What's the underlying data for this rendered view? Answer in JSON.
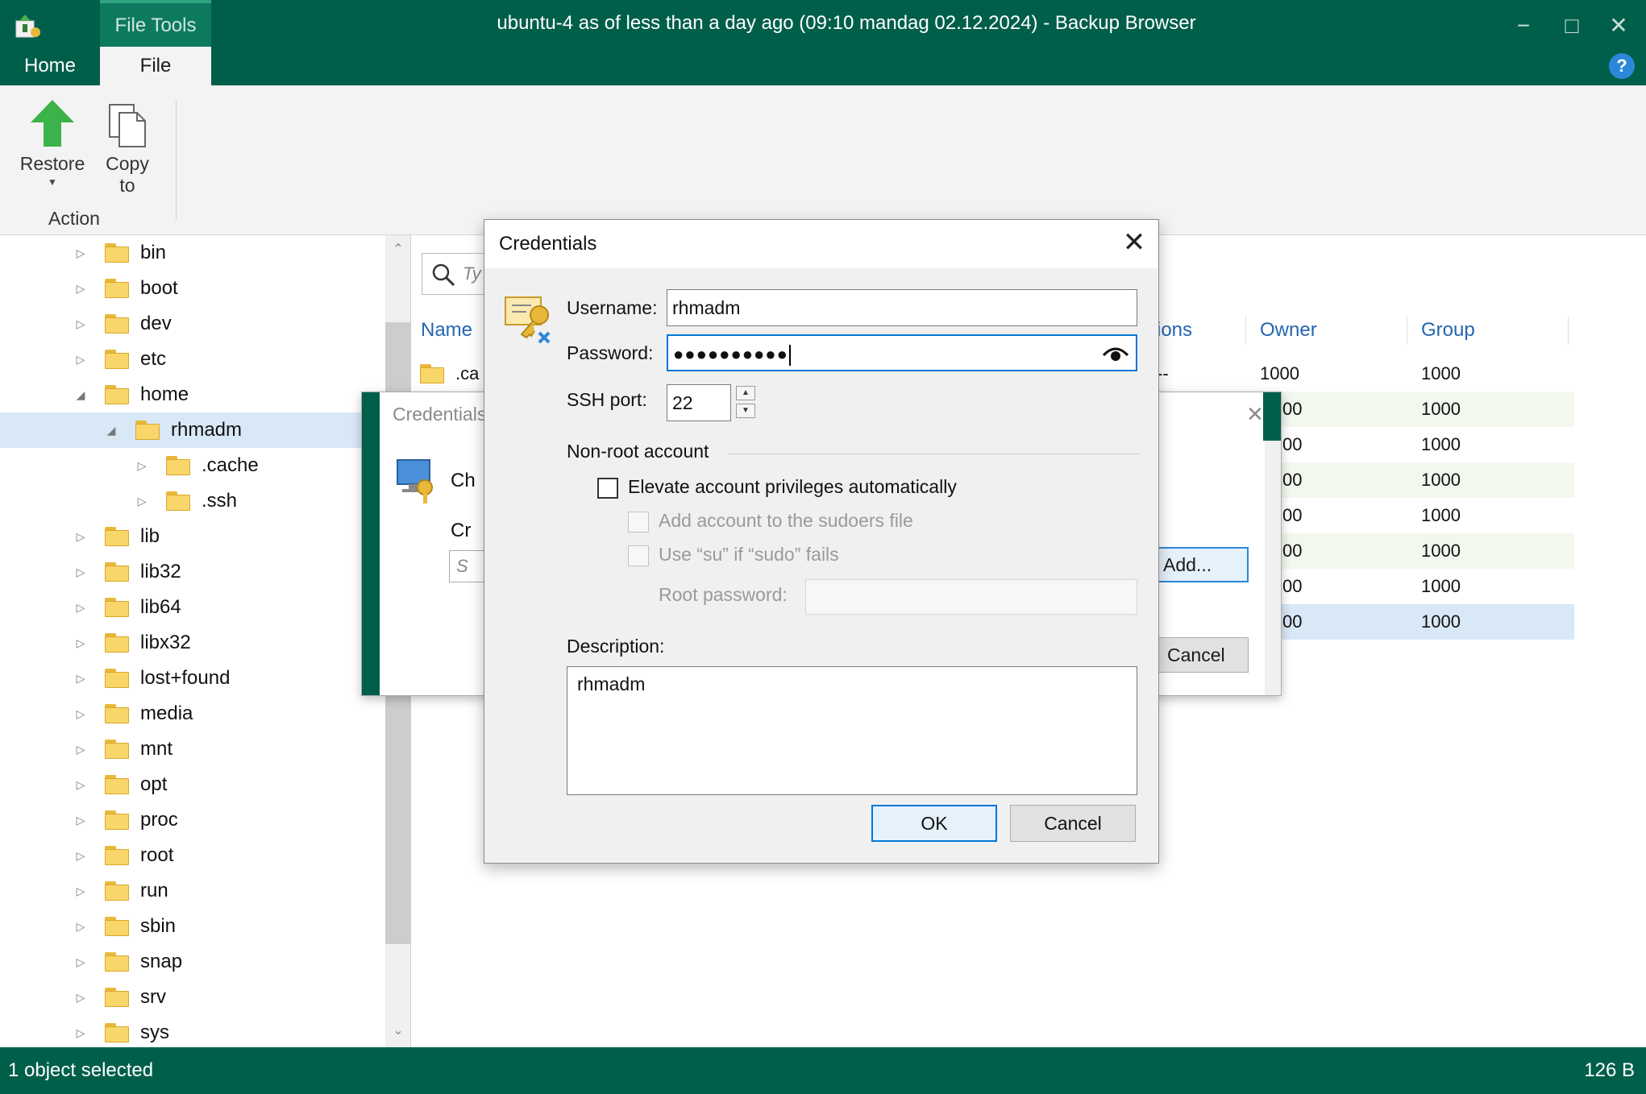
{
  "window": {
    "title": "ubuntu-4 as of less than a day ago (09:10 mandag 02.12.2024) - Backup Browser",
    "context_tab": "File Tools",
    "tabs": [
      "Home",
      "File"
    ],
    "minimize_glyph": "−",
    "maximize_glyph": "□",
    "close_glyph": "✕",
    "help_glyph": "?"
  },
  "ribbon": {
    "restore_label": "Restore",
    "copy_label_1": "Copy",
    "copy_label_2": "to",
    "group_label": "Action"
  },
  "tree": {
    "items": [
      {
        "label": "bin",
        "indent": 0,
        "expanded": false,
        "selected": false
      },
      {
        "label": "boot",
        "indent": 0,
        "expanded": false,
        "selected": false
      },
      {
        "label": "dev",
        "indent": 0,
        "expanded": false,
        "selected": false
      },
      {
        "label": "etc",
        "indent": 0,
        "expanded": false,
        "selected": false
      },
      {
        "label": "home",
        "indent": 0,
        "expanded": true,
        "selected": false
      },
      {
        "label": "rhmadm",
        "indent": 1,
        "expanded": true,
        "selected": true
      },
      {
        "label": ".cache",
        "indent": 2,
        "expanded": false,
        "selected": false
      },
      {
        "label": ".ssh",
        "indent": 2,
        "expanded": false,
        "selected": false
      },
      {
        "label": "lib",
        "indent": 0,
        "expanded": false,
        "selected": false
      },
      {
        "label": "lib32",
        "indent": 0,
        "expanded": false,
        "selected": false
      },
      {
        "label": "lib64",
        "indent": 0,
        "expanded": false,
        "selected": false
      },
      {
        "label": "libx32",
        "indent": 0,
        "expanded": false,
        "selected": false
      },
      {
        "label": "lost+found",
        "indent": 0,
        "expanded": false,
        "selected": false
      },
      {
        "label": "media",
        "indent": 0,
        "expanded": false,
        "selected": false
      },
      {
        "label": "mnt",
        "indent": 0,
        "expanded": false,
        "selected": false
      },
      {
        "label": "opt",
        "indent": 0,
        "expanded": false,
        "selected": false
      },
      {
        "label": "proc",
        "indent": 0,
        "expanded": false,
        "selected": false
      },
      {
        "label": "root",
        "indent": 0,
        "expanded": false,
        "selected": false
      },
      {
        "label": "run",
        "indent": 0,
        "expanded": false,
        "selected": false
      },
      {
        "label": "sbin",
        "indent": 0,
        "expanded": false,
        "selected": false
      },
      {
        "label": "snap",
        "indent": 0,
        "expanded": false,
        "selected": false
      },
      {
        "label": "srv",
        "indent": 0,
        "expanded": false,
        "selected": false
      },
      {
        "label": "sys",
        "indent": 0,
        "expanded": false,
        "selected": false
      }
    ]
  },
  "list": {
    "search_placeholder": "Ty",
    "columns": {
      "name": "Name",
      "permissions": "ions",
      "owner": "Owner",
      "group": "Group"
    },
    "first_row_name": ".ca",
    "first_row_perm": "--",
    "owner_fragment": "00",
    "rows": [
      {
        "owner": "1000",
        "group": "1000"
      },
      {
        "owner": "1000",
        "group": "1000"
      },
      {
        "owner": "1000",
        "group": "1000"
      },
      {
        "owner": "1000",
        "group": "1000"
      },
      {
        "owner": "1000",
        "group": "1000"
      },
      {
        "owner": "1000",
        "group": "1000"
      },
      {
        "owner": "1000",
        "group": "1000"
      },
      {
        "owner": "1000",
        "group": "1000"
      }
    ]
  },
  "background_dialog": {
    "title": "Credentials",
    "heading": "Ch",
    "label": "Cr",
    "input_placeholder": "S",
    "add_label": "Add...",
    "cancel_label": "Cancel"
  },
  "credentials_dialog": {
    "title": "Credentials",
    "username_label": "Username:",
    "username_value": "rhmadm",
    "password_label": "Password:",
    "password_mask": "●●●●●●●●●●",
    "ssh_port_label": "SSH port:",
    "ssh_port_value": "22",
    "nonroot_label": "Non-root account",
    "elevate_label": "Elevate account privileges automatically",
    "sudoers_label": "Add account to the sudoers file",
    "su_label": "Use “su” if “sudo” fails",
    "root_password_label": "Root password:",
    "description_label": "Description:",
    "description_value": "rhmadm",
    "ok_label": "OK",
    "cancel_label": "Cancel"
  },
  "status": {
    "left": "1 object selected",
    "right": "126 B"
  },
  "colors": {
    "brand_green": "#005f4b",
    "accent_blue": "#0078d7",
    "folder_yellow": "#f9d66a",
    "selection": "#d9e8f7"
  }
}
